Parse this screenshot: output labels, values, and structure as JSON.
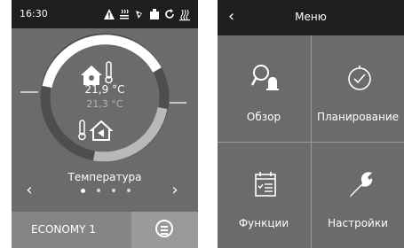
{
  "status": {
    "time": "16:30",
    "icons": [
      "warning-icon",
      "heating-icon",
      "fan-icon",
      "filter-icon",
      "sync-icon",
      "heat-wave-icon"
    ]
  },
  "thermostat": {
    "temp_main": "21,9 °C",
    "temp_secondary": "21,3 °C",
    "label": "Температура",
    "page_count": 4,
    "active_page": 1
  },
  "footer": {
    "mode": "ECONOMY 1"
  },
  "menu": {
    "title": "Меню",
    "tiles": [
      {
        "label": "Обзор",
        "icon": "search-bell-icon"
      },
      {
        "label": "Планирование",
        "icon": "clock-icon"
      },
      {
        "label": "Функции",
        "icon": "calendar-list-icon"
      },
      {
        "label": "Настройки",
        "icon": "wrench-icon"
      }
    ]
  },
  "colors": {
    "panel_bg": "#6b6b6b",
    "header_bg": "#1e1e1e",
    "ring": "#ffffff"
  }
}
